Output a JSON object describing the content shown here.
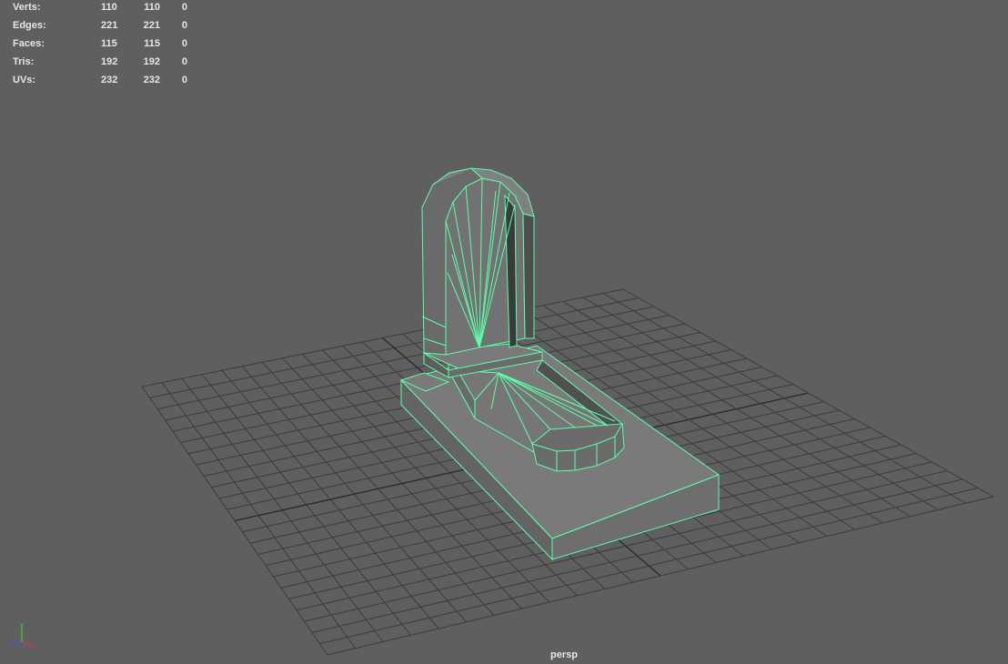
{
  "hud": {
    "rows": [
      {
        "label": "Verts:",
        "a": "110",
        "b": "110",
        "c": "0"
      },
      {
        "label": "Edges:",
        "a": "221",
        "b": "221",
        "c": "0"
      },
      {
        "label": "Faces:",
        "a": "115",
        "b": "115",
        "c": "0"
      },
      {
        "label": "Tris:",
        "a": "192",
        "b": "192",
        "c": "0"
      },
      {
        "label": "UVs:",
        "a": "232",
        "b": "232",
        "c": "0"
      }
    ]
  },
  "viewport": {
    "camera": "persp",
    "background_color": "#5f5f5f",
    "grid_color": "#3c3c3c",
    "grid_axis_color": "#2a2a2a",
    "wire_color": "#5dffa9",
    "mesh_fill_color": "#777777"
  },
  "axis_gizmo": {
    "x_label": "x",
    "y_label": "y",
    "z_label": "z",
    "x_color": "#d83a3a",
    "y_color": "#3fd13f",
    "z_color": "#3a5ad8"
  }
}
